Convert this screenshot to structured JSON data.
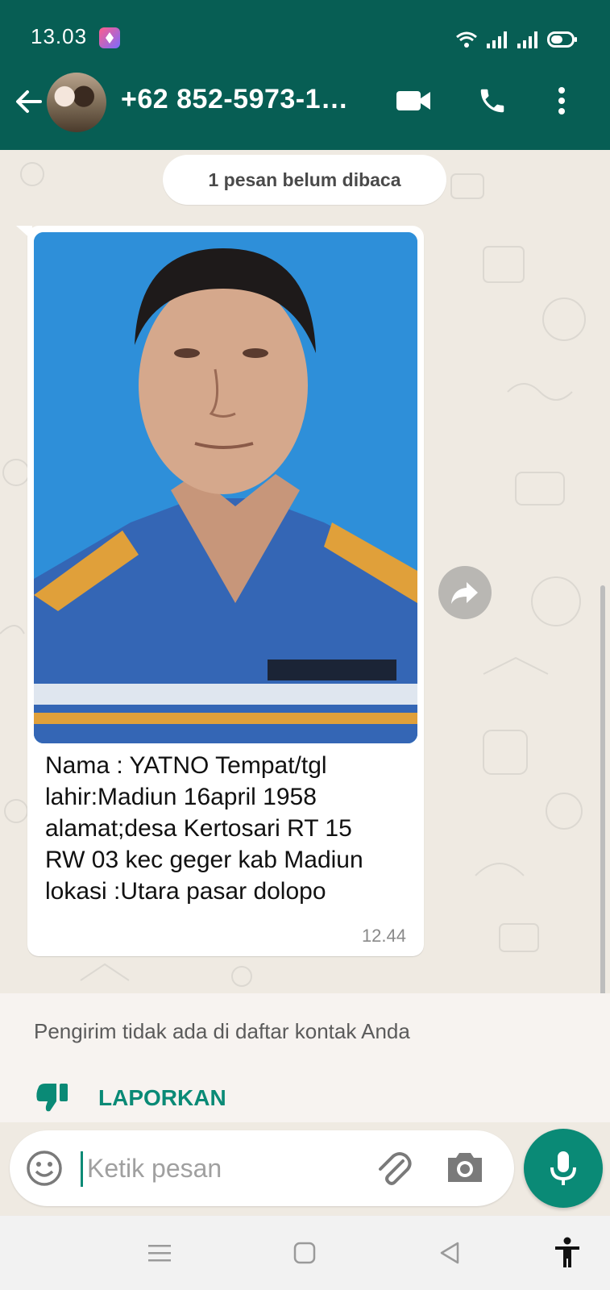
{
  "status_bar": {
    "time": "13.03"
  },
  "header": {
    "contact_name": "+62 852-5973-1…"
  },
  "chat": {
    "unread_banner": "1 pesan belum dibaca",
    "message": {
      "caption": "Nama : YATNO Tempat/tgl\nlahir:Madiun 16april 1958\nalamat;desa Kertosari RT 15\nRW 03 kec geger kab Madiun\nlokasi :Utara pasar dolopo",
      "time": "12.44"
    }
  },
  "notice": {
    "text": "Pengirim tidak ada di daftar kontak Anda",
    "report_label": "LAPORKAN"
  },
  "input": {
    "placeholder": "Ketik pesan"
  },
  "colors": {
    "primary": "#075e54",
    "accent": "#0a8a76",
    "chat_bg": "#efeae2"
  },
  "icons": [
    "back-arrow-icon",
    "video-call-icon",
    "phone-icon",
    "more-options-icon",
    "forward-icon",
    "thumbs-down-icon",
    "emoji-icon",
    "attach-icon",
    "camera-icon",
    "mic-icon",
    "menu-icon",
    "home-icon",
    "back-nav-icon",
    "accessibility-icon"
  ]
}
